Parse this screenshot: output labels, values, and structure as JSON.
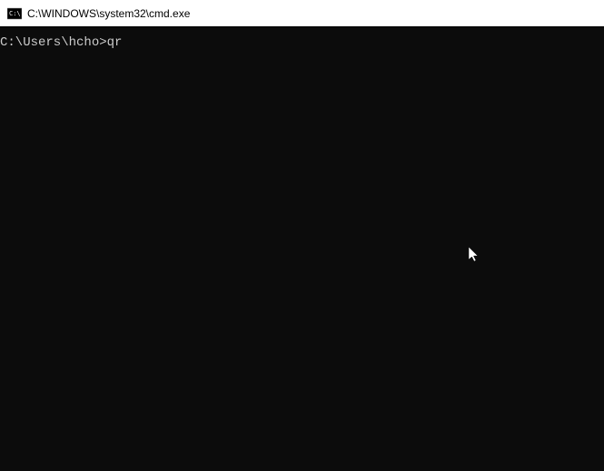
{
  "titlebar": {
    "title": "C:\\WINDOWS\\system32\\cmd.exe"
  },
  "terminal": {
    "prompt": "C:\\Users\\hcho>",
    "command": "qr"
  }
}
